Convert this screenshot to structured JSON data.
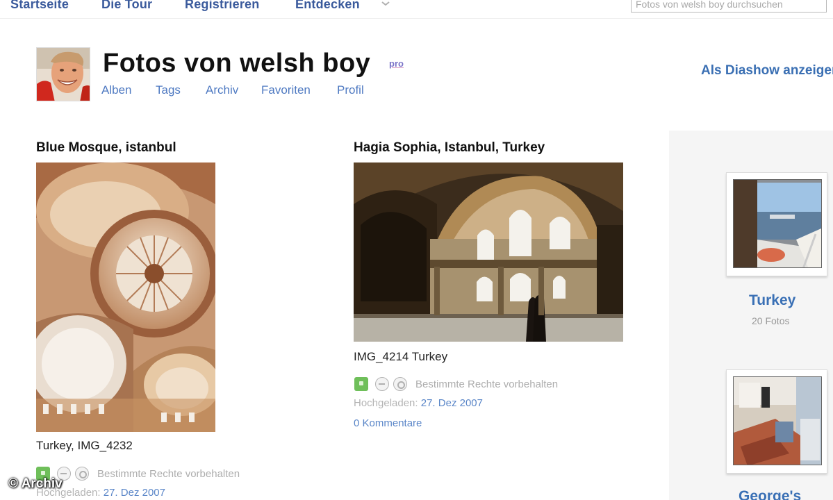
{
  "nav": {
    "items": [
      "Startseite",
      "Die Tour",
      "Registrieren",
      "Entdecken"
    ],
    "search_placeholder": "Fotos von welsh boy durchsuchen"
  },
  "header": {
    "title": "Fotos von welsh boy",
    "badge": "pro",
    "subnav": [
      "Alben",
      "Tags",
      "Archiv",
      "Favoriten",
      "Profil"
    ],
    "slideshow": "Als Diashow anzeigen"
  },
  "photos": [
    {
      "title": "Blue Mosque, istanbul",
      "caption": "Turkey, IMG_4232",
      "license": "Bestimmte Rechte vorbehalten",
      "uploaded_label": "Hochgeladen:",
      "uploaded_date": "27. Dez 2007"
    },
    {
      "title": "Hagia Sophia, Istanbul, Turkey",
      "caption": "IMG_4214 Turkey",
      "license": "Bestimmte Rechte vorbehalten",
      "uploaded_label": "Hochgeladen:",
      "uploaded_date": "27. Dez 2007",
      "comments": "0 Kommentare"
    }
  ],
  "sidebar": {
    "sets": [
      {
        "title": "Turkey",
        "count": "20 Fotos"
      },
      {
        "title": "George's"
      }
    ]
  },
  "watermark": "© Archiv",
  "colors": {
    "link": "#4f7ac2",
    "title": "#111111",
    "license_green": "#6fbf5a"
  }
}
